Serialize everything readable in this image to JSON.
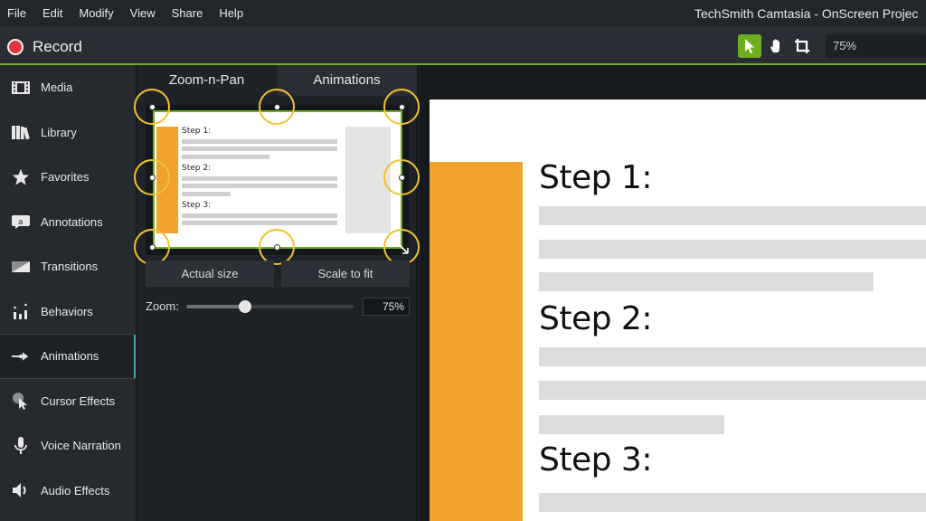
{
  "menu": {
    "items": [
      "File",
      "Edit",
      "Modify",
      "View",
      "Share",
      "Help"
    ]
  },
  "window_title": "TechSmith Camtasia - OnScreen Projec",
  "toolbar": {
    "record_label": "Record",
    "tools": [
      {
        "icon": "arrow-pointer-icon",
        "active": true
      },
      {
        "icon": "hand-pan-icon",
        "active": false
      },
      {
        "icon": "crop-icon",
        "active": false
      }
    ],
    "zoom_value": "75%"
  },
  "sidebar": {
    "items": [
      {
        "label": "Media",
        "icon": "film-strip-icon"
      },
      {
        "label": "Library",
        "icon": "library-books-icon"
      },
      {
        "label": "Favorites",
        "icon": "star-icon"
      },
      {
        "label": "Annotations",
        "icon": "annotation-icon"
      },
      {
        "label": "Transitions",
        "icon": "transition-icon"
      },
      {
        "label": "Behaviors",
        "icon": "behaviors-icon"
      },
      {
        "label": "Animations",
        "icon": "animation-arrow-icon"
      },
      {
        "label": "Cursor Effects",
        "icon": "cursor-effects-icon"
      },
      {
        "label": "Voice Narration",
        "icon": "microphone-icon"
      },
      {
        "label": "Audio Effects",
        "icon": "speaker-icon"
      }
    ],
    "active_index": 6
  },
  "panel": {
    "tabs": [
      "Zoom-n-Pan",
      "Animations"
    ],
    "active_tab": 0,
    "actual_size_label": "Actual size",
    "scale_to_fit_label": "Scale to fit",
    "zoom_label": "Zoom:",
    "zoom_value": "75%",
    "zoom_level": 0.35
  },
  "mini_slide": {
    "steps": [
      "Step 1:",
      "Step 2:",
      "Step 3:"
    ]
  },
  "stage": {
    "steps": [
      "Step 1:",
      "Step 2:",
      "Step 3:"
    ]
  },
  "colors": {
    "accent_green": "#6fae1f",
    "record_red": "#e0383e",
    "slide_orange": "#f0a22c",
    "handle_yellow": "#f2c230",
    "active_teal": "#3ab0a8"
  }
}
